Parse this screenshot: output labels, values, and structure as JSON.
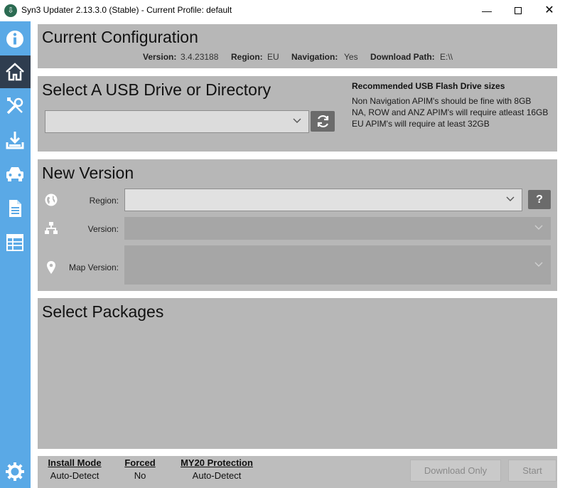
{
  "window": {
    "title": "Syn3 Updater 2.13.3.0 (Stable) - Current Profile: default",
    "minimize": "—",
    "close": "✕"
  },
  "sidebar": {
    "items": [
      {
        "icon": "info-icon",
        "active": false
      },
      {
        "icon": "home-icon",
        "active": true
      },
      {
        "icon": "tools-icon",
        "active": false
      },
      {
        "icon": "download-icon",
        "active": false
      },
      {
        "icon": "car-icon",
        "active": false
      },
      {
        "icon": "document-icon",
        "active": false
      },
      {
        "icon": "table-icon",
        "active": false
      },
      {
        "icon": "gear-icon",
        "active": false
      }
    ],
    "color": "#5aa9e6",
    "active_color": "#2f3d4f"
  },
  "current_config": {
    "title": "Current Configuration",
    "version_label": "Version:",
    "version_value": "3.4.23188",
    "region_label": "Region:",
    "region_value": "EU",
    "navigation_label": "Navigation:",
    "navigation_value": "Yes",
    "download_path_label": "Download Path:",
    "download_path_value": "E:\\\\"
  },
  "usb": {
    "title": "Select A USB Drive or Directory",
    "selected": "",
    "rec_title": "Recommended USB Flash Drive sizes",
    "rec_lines": [
      "Non Navigation APIM's should be fine with 8GB",
      "NA, ROW and ANZ APIM's will require atleast 16GB",
      "EU APIM's will require at least 32GB"
    ]
  },
  "new_version": {
    "title": "New Version",
    "region_label": "Region:",
    "region_value": "",
    "help_label": "?",
    "version_label": "Version:",
    "version_value": "",
    "map_version_label": "Map Version:",
    "map_version_value": ""
  },
  "packages": {
    "title": "Select Packages"
  },
  "footer": {
    "install_mode_label": "Install Mode",
    "install_mode_value": "Auto-Detect",
    "forced_label": "Forced",
    "forced_value": "No",
    "my20_label": "MY20 Protection",
    "my20_value": "Auto-Detect",
    "download_only_label": "Download Only",
    "start_label": "Start"
  }
}
